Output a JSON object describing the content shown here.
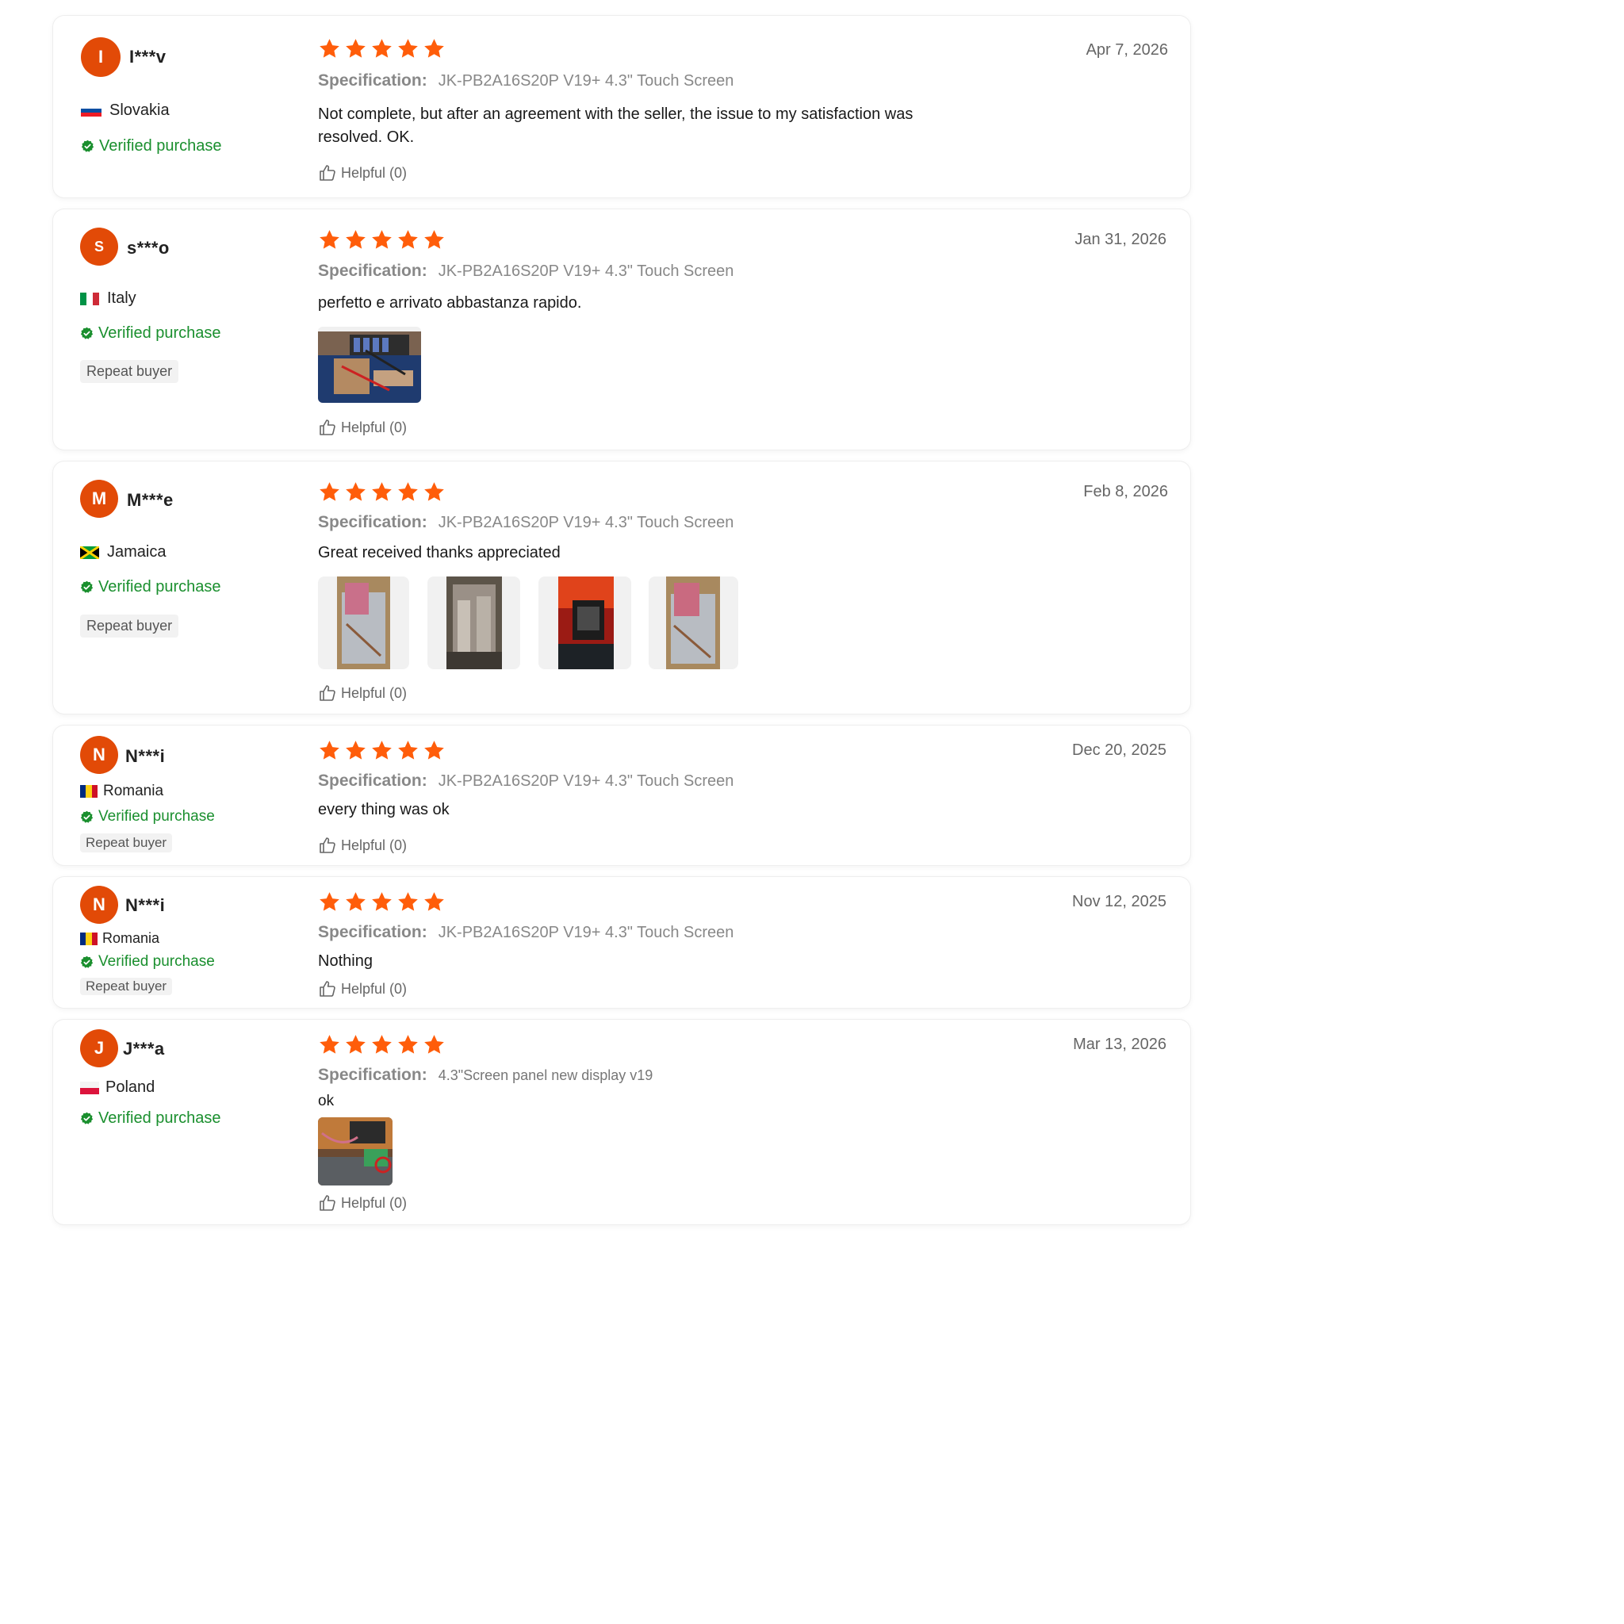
{
  "helpful_label": "Helpful (0)",
  "spec_label": "Specification:",
  "colors": {
    "accent": "#e24a07",
    "star": "#ff5d0a",
    "verified": "#1a8f2e"
  },
  "reviews": [
    {
      "initial": "I",
      "user": "I***v",
      "country": "Slovakia",
      "verified": "Verified purchase",
      "date": "Apr 7, 2026",
      "rating": 5,
      "spec": "JK-PB2A16S20P V19+ 4.3\" Touch Screen",
      "text": "Not complete, but after an agreement with the seller, the issue to my satisfaction was resolved. OK."
    },
    {
      "initial": "S",
      "user": "s***o",
      "country": "Italy",
      "verified": "Verified purchase",
      "badge": "Repeat buyer",
      "date": "Jan 31, 2026",
      "rating": 5,
      "spec": "JK-PB2A16S20P V19+ 4.3\" Touch Screen",
      "text": "perfetto e arrivato abbastanza rapido."
    },
    {
      "initial": "M",
      "user": "M***e",
      "country": "Jamaica",
      "verified": "Verified purchase",
      "badge": "Repeat buyer",
      "date": "Feb 8, 2026",
      "rating": 5,
      "spec": "JK-PB2A16S20P V19+ 4.3\" Touch Screen",
      "text": "Great received thanks appreciated"
    },
    {
      "initial": "N",
      "user": "N***i",
      "country": "Romania",
      "verified": "Verified purchase",
      "badge": "Repeat buyer",
      "date": "Dec 20, 2025",
      "rating": 5,
      "spec": "JK-PB2A16S20P V19+ 4.3\" Touch Screen",
      "text": "every thing was ok"
    },
    {
      "initial": "N",
      "user": "N***i",
      "country": "Romania",
      "verified": "Verified purchase",
      "badge": "Repeat buyer",
      "date": "Nov 12, 2025",
      "rating": 5,
      "spec": "JK-PB2A16S20P V19+ 4.3\" Touch Screen",
      "text": "Nothing"
    },
    {
      "initial": "J",
      "user": "J***a",
      "country": "Poland",
      "verified": "Verified purchase",
      "date": "Mar 13, 2026",
      "rating": 5,
      "spec": "4.3\"Screen panel new display v19",
      "text": "ok"
    }
  ]
}
